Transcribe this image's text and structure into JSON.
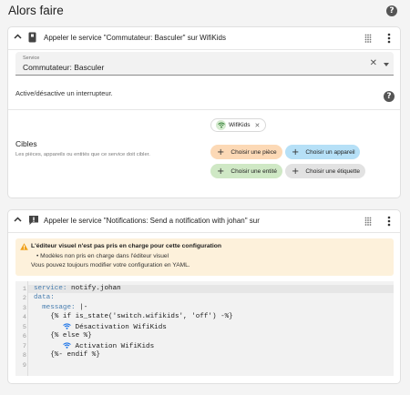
{
  "header": {
    "title": "Alors faire"
  },
  "card1": {
    "title": "Appeler le service \"Commutateur: Basculer\" sur WifiKids",
    "service_field": {
      "label": "Service",
      "value": "Commutateur: Basculer"
    },
    "description": "Active/désactive un interrupteur.",
    "targets": {
      "label": "Cibles",
      "description": "Les pièces, appareils ou entités que ce service doit cibler.",
      "chip": "WifiKids",
      "buttons": {
        "area": "Choisir une pièce",
        "device": "Choisir un appareil",
        "entity": "Choisir une entité",
        "label": "Choisir une étiquette"
      }
    }
  },
  "card2": {
    "title": "Appeler le service \"Notifications: Send a notification with johan\" sur",
    "warning": {
      "title": "L'éditeur visuel n'est pas pris en charge pour cette configuration",
      "bullet": "Modèles non pris en charge dans l'éditeur visuel",
      "note": "Vous pouvez toujours modifier votre configuration en YAML."
    },
    "yaml": {
      "line_numbers": [
        "1",
        "2",
        "3",
        "4",
        "5",
        "6",
        "7",
        "8",
        "9"
      ],
      "l1_key": "service:",
      "l1_val": " notify.johan",
      "l2_key": "data:",
      "l3_key": "  message:",
      "l3_val": " |-",
      "l4": "    {% if is_state('switch.wifikids', 'off') -%}",
      "l5": " Désactivation WifiKids",
      "l6": "    {% else %}",
      "l7": " Activation WifiKids",
      "l8": "    {%- endif %}"
    }
  },
  "colors": {
    "area": "#fcd9b6",
    "device": "#b6e0f7",
    "entity": "#cfe8c5",
    "label": "#e2e2e2",
    "warning_bg": "#fdf1db",
    "warning_icon": "#f0a11a",
    "wifi_blue": "#1a73e8"
  },
  "icons": {
    "help": "help-circle-icon",
    "chevron": "chevron-up-icon",
    "switch": "switch-icon",
    "alert": "alert-message-icon",
    "drag": "drag-handle-icon",
    "menu": "dots-vertical-icon",
    "wifi": "wifi-icon",
    "plus": "plus-icon",
    "warning": "alert-triangle-icon"
  }
}
